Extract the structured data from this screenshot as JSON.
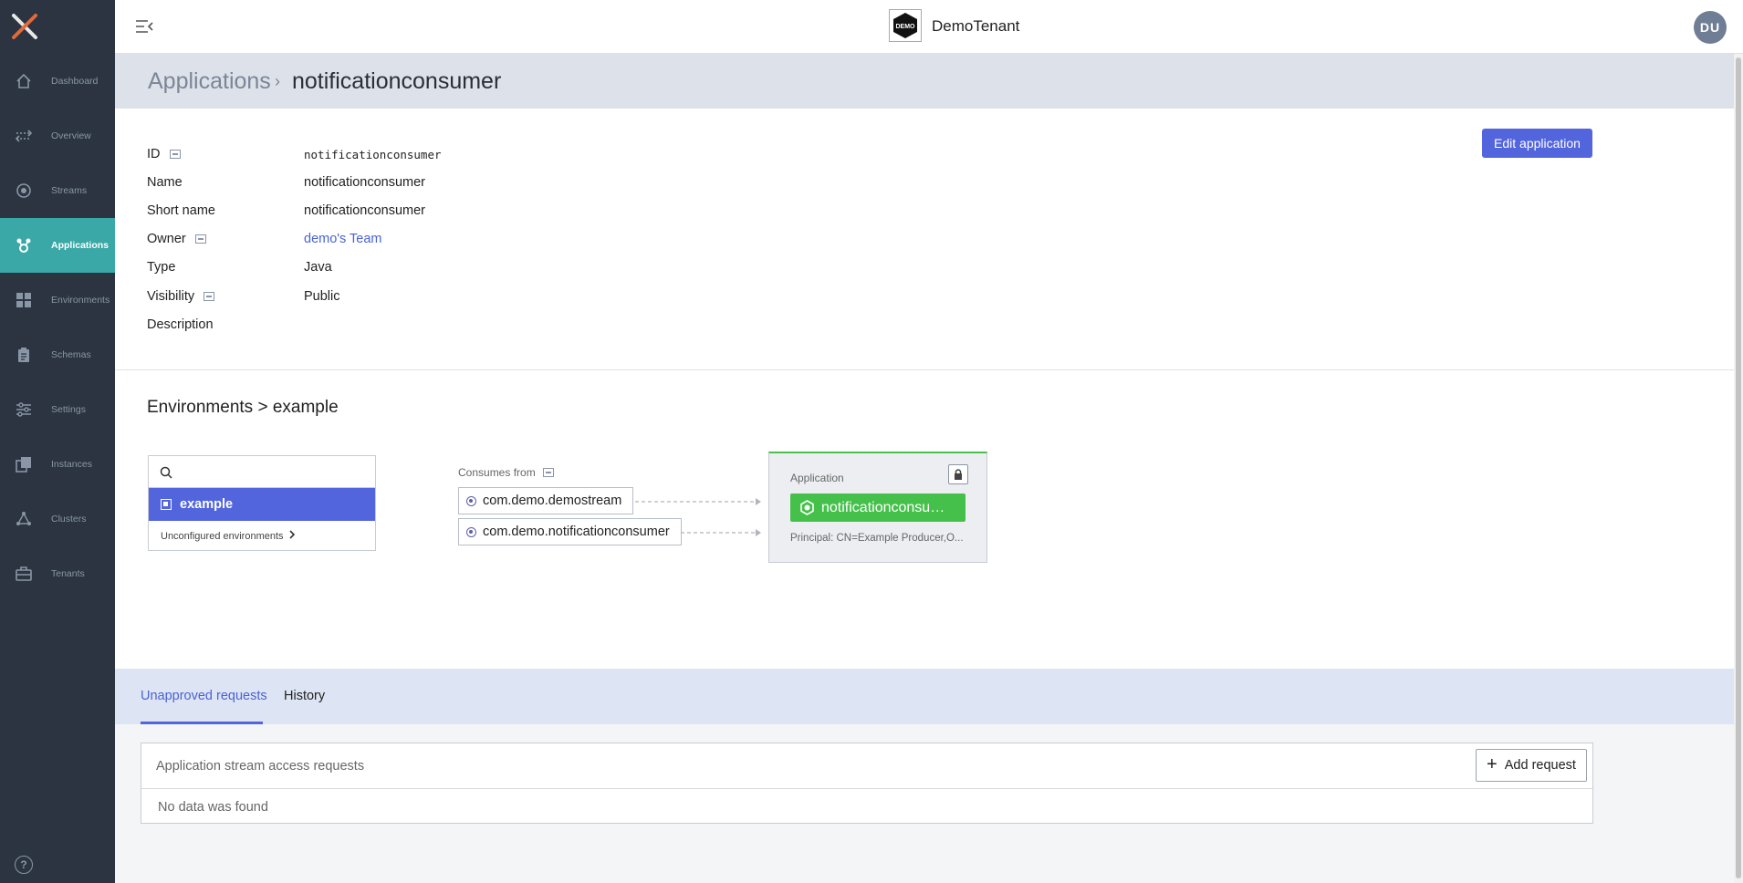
{
  "sidebar": {
    "items": [
      {
        "label": "Dashboard",
        "icon": "home-icon"
      },
      {
        "label": "Overview",
        "icon": "overview-icon"
      },
      {
        "label": "Streams",
        "icon": "streams-icon"
      },
      {
        "label": "Applications",
        "icon": "applications-icon"
      },
      {
        "label": "Environments",
        "icon": "grid-icon"
      },
      {
        "label": "Schemas",
        "icon": "clipboard-icon"
      },
      {
        "label": "Settings",
        "icon": "sliders-icon"
      },
      {
        "label": "Instances",
        "icon": "instances-icon"
      },
      {
        "label": "Clusters",
        "icon": "clusters-icon"
      },
      {
        "label": "Tenants",
        "icon": "briefcase-icon"
      }
    ],
    "active_index": 3,
    "help_label": "?"
  },
  "topbar": {
    "tenant_logo_text": "DEMO",
    "tenant_name": "DemoTenant",
    "avatar_initials": "DU"
  },
  "breadcrumb": {
    "root": "Applications",
    "separator": "›",
    "current": "notificationconsumer"
  },
  "details": {
    "rows": [
      {
        "label": "ID",
        "value": "notificationconsumer"
      },
      {
        "label": "Name",
        "value": "notificationconsumer"
      },
      {
        "label": "Short name",
        "value": "notificationconsumer"
      },
      {
        "label": "Owner",
        "value": "demo's Team"
      },
      {
        "label": "Type",
        "value": "Java"
      },
      {
        "label": "Visibility",
        "value": "Public"
      },
      {
        "label": "Description",
        "value": ""
      }
    ],
    "edit_button": "Edit application"
  },
  "environments": {
    "title": "Environments > example",
    "search_placeholder": "",
    "selected": "example",
    "unconfigured_label": "Unconfigured environments",
    "consumes_from_label": "Consumes from",
    "streams": [
      "com.demo.demostream",
      "com.demo.notificationconsumer"
    ],
    "app_card": {
      "type_label": "Application",
      "name": "notificationconsumer",
      "name_display": "notificationconsu…",
      "principal": "Principal: CN=Example Producer,O..."
    }
  },
  "requests": {
    "tabs": [
      "Unapproved requests",
      "History"
    ],
    "active_tab": 0,
    "panel_title": "Application stream access requests",
    "add_button": "Add request",
    "empty_text": "No data was found"
  },
  "colors": {
    "sidebar_bg": "#2b3440",
    "active_nav": "#3aa8a7",
    "primary": "#5265dd",
    "app_green": "#45c04b"
  }
}
